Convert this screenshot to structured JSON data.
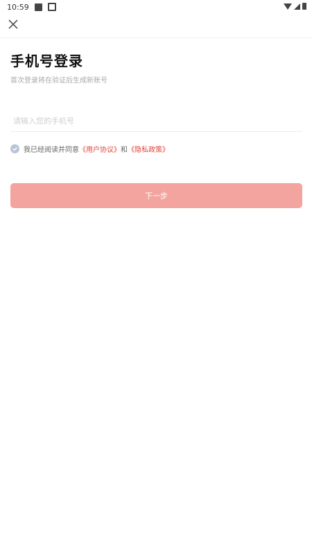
{
  "status_bar": {
    "time": "10:59"
  },
  "icons": {
    "close": "close-icon",
    "check": "check-circle-icon"
  },
  "header": {
    "title": "手机号登录",
    "subtitle": "首次登录将在验证后生成新账号"
  },
  "phone": {
    "value": "",
    "placeholder": "请输入您的手机号"
  },
  "agreement": {
    "prefix": "我已经阅读并同意",
    "user_agreement": "《用户协议》",
    "and": "和",
    "privacy_policy": "《隐私政策》"
  },
  "next_button": {
    "label": "下一步"
  },
  "colors": {
    "accent": "#e0443a",
    "button": "#f3a49f",
    "check": "#b9c4d6"
  }
}
